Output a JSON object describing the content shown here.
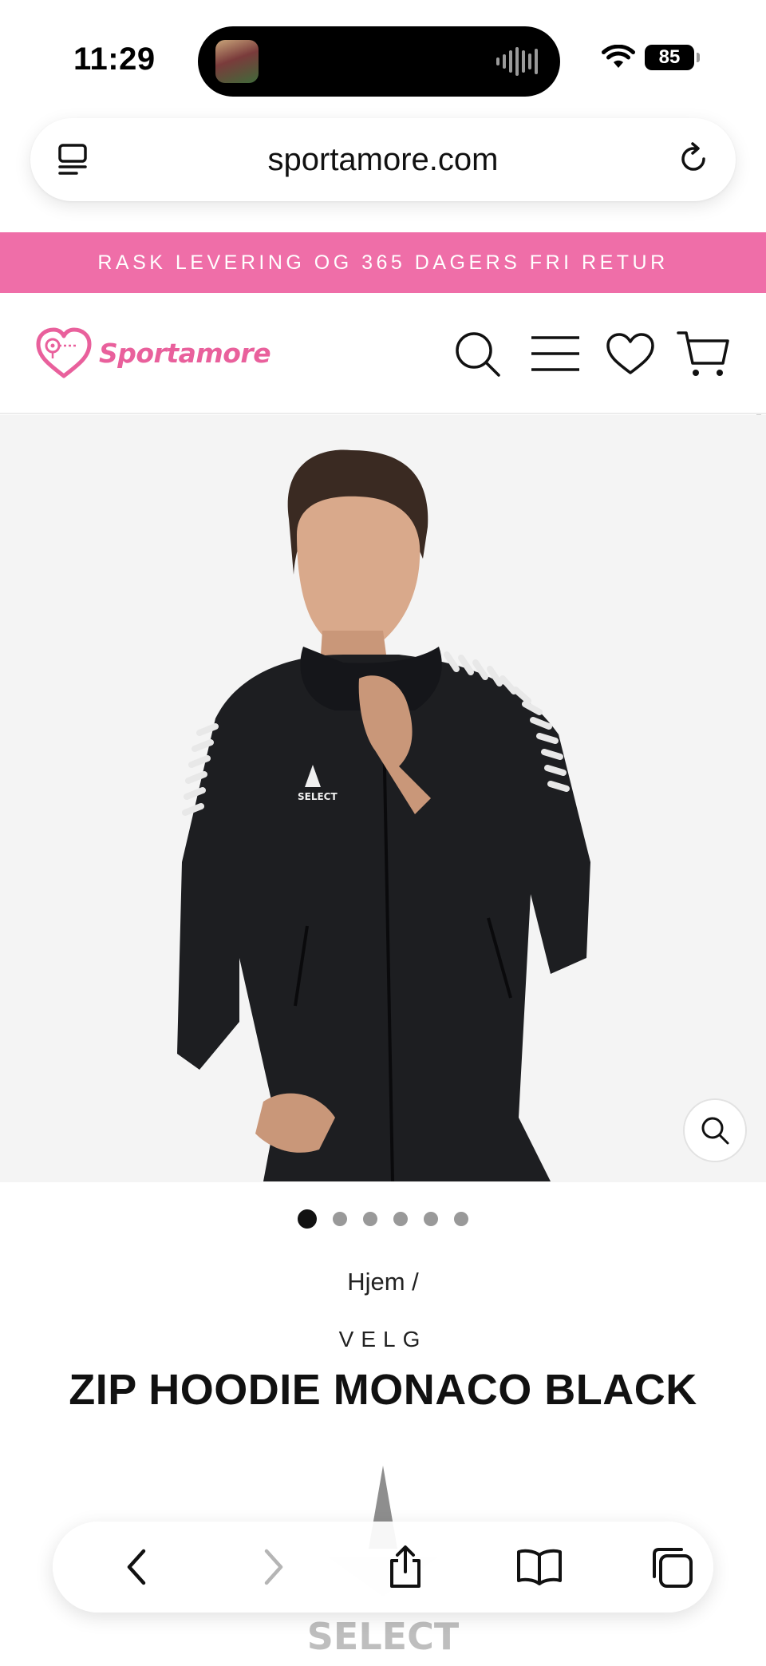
{
  "status_bar": {
    "time": "11:29",
    "battery": "85"
  },
  "browser": {
    "url": "sportamore.com"
  },
  "promo": {
    "text": "RASK LEVERING OG 365 DAGERS FRI RETUR",
    "color": "#ef6ea8"
  },
  "header": {
    "logo_text": "Sportamore",
    "icons": [
      "search-icon",
      "menu-icon",
      "heart-icon",
      "cart-icon"
    ]
  },
  "product": {
    "brand_mark_text": "SELECT",
    "image_count": 6,
    "active_image": 1,
    "breadcrumb": "Hjem /",
    "brand": "VELG",
    "title": "ZIP HOODIE MONACO BLACK"
  },
  "toolbar": {
    "icons": [
      "back-icon",
      "forward-icon",
      "share-icon",
      "bookmarks-icon",
      "tabs-icon"
    ]
  }
}
